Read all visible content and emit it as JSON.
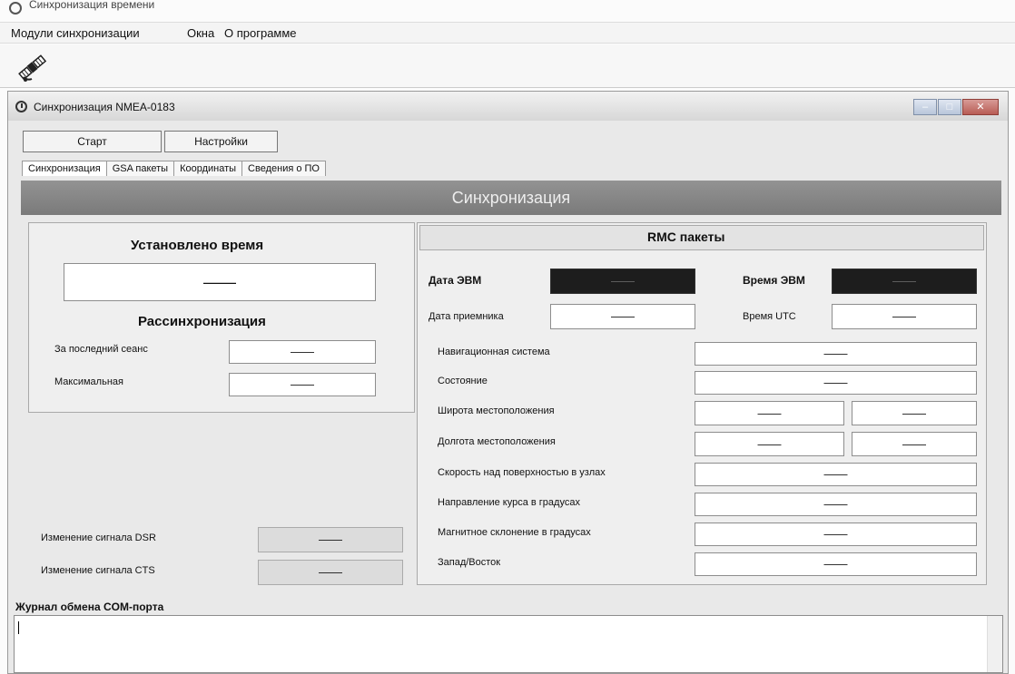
{
  "app": {
    "title": "Синхронизация времени"
  },
  "menu": {
    "modules": "Модули синхронизации",
    "windows": "Окна",
    "about": "О программе"
  },
  "child": {
    "title": "Синхронизация NMEA-0183",
    "start": "Старт",
    "settings": "Настройки",
    "tabs": [
      "Синхронизация",
      "GSA пакеты",
      "Координаты",
      "Сведения о ПО"
    ],
    "banner": "Синхронизация",
    "win": {
      "min": "–",
      "max": "□",
      "close": "✕"
    }
  },
  "left": {
    "time_set": "Установлено время",
    "time_value": "——",
    "desync": "Рассинхронизация",
    "last_session": "За последний сеанс",
    "last_session_value": "——",
    "max": "Максимальная",
    "max_value": "——",
    "dsr": "Изменение сигнала DSR",
    "dsr_value": "——",
    "cts": "Изменение сигнала CTS",
    "cts_value": "——"
  },
  "rmc": {
    "title": "RMC пакеты",
    "pc_date": "Дата ЭВМ",
    "pc_date_value": "——",
    "pc_time": "Время ЭВМ",
    "pc_time_value": "——",
    "rx_date": "Дата приемника",
    "rx_date_value": "——",
    "utc_time": "Время UTC",
    "utc_time_value": "——",
    "nav_system": "Навигационная система",
    "nav_system_value": "——",
    "state": "Состояние",
    "state_value": "——",
    "lat": "Широта местоположения",
    "lat_value_1": "——",
    "lat_value_2": "——",
    "lon": "Долгота местоположения",
    "lon_value_1": "——",
    "lon_value_2": "——",
    "speed": "Скорость над поверхностью в узлах",
    "speed_value": "——",
    "course": "Направление курса в градусах",
    "course_value": "——",
    "magvar": "Магнитное склонение в градусах",
    "magvar_value": "——",
    "ew": "Запад/Восток",
    "ew_value": "——"
  },
  "log": {
    "title": "Журнал обмена COM-порта"
  }
}
